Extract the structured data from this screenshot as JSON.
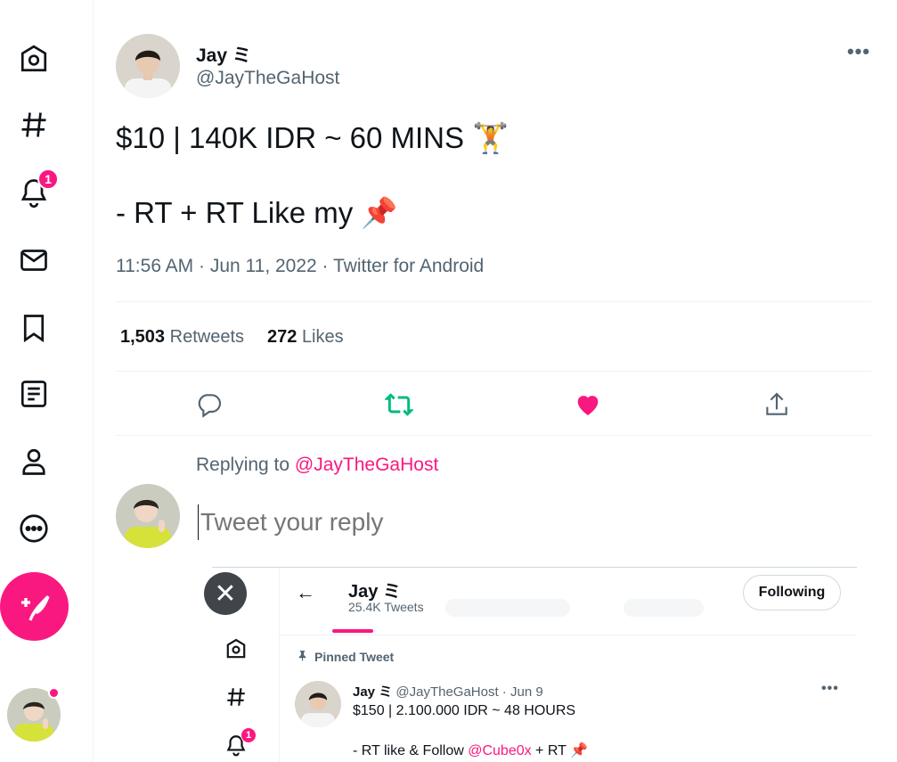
{
  "nav": {
    "notifications_badge": "1",
    "items": [
      "home-icon",
      "explore-icon",
      "notifications-icon",
      "messages-icon",
      "bookmarks-icon",
      "lists-icon",
      "profile-icon",
      "more-icon"
    ]
  },
  "tweet": {
    "author_name": "Jay ミ",
    "author_handle": "@JayTheGaHost",
    "more": "•••",
    "line1": "$10 | 140K IDR ~ 60 MINS 🏋️",
    "line2": "- RT + RT Like my 📌",
    "timestamp": "11:56 AM · Jun 11, 2022 · Twitter for Android",
    "retweets_count": "1,503",
    "retweets_label": "Retweets",
    "likes_count": "272",
    "likes_label": "Likes"
  },
  "reply": {
    "replying_to_label": "Replying to ",
    "replying_to_handle": "@JayTheGaHost",
    "placeholder": "Tweet your reply"
  },
  "embed": {
    "close": "✕",
    "back": "←",
    "profile_name": "Jay ミ",
    "tweets_count": "25.4K Tweets",
    "following_button": "Following",
    "notifications_badge": "1",
    "pinned_label": "Pinned Tweet",
    "tweet_name": "Jay ミ",
    "tweet_handle_date": "@JayTheGaHost · Jun 9",
    "tweet_line1": "$150 | 2.100.000 IDR ~ 48 HOURS",
    "tweet_line2_prefix": "- RT like & Follow ",
    "tweet_line2_mention": "@Cube0x",
    "tweet_line2_suffix": " + RT 📌",
    "more": "•••"
  },
  "colors": {
    "accent": "#f91880",
    "retweet": "#00ba7c",
    "text": "#0f1419",
    "muted": "#536471"
  }
}
